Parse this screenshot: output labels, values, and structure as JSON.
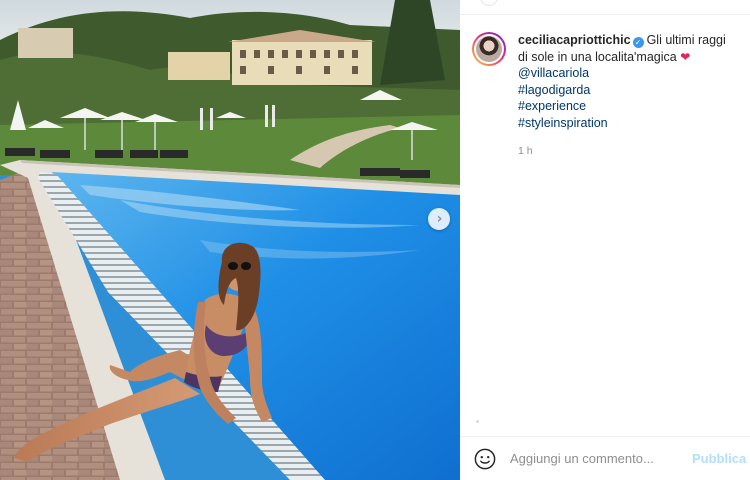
{
  "post": {
    "username": "ceciliacapriottichic",
    "verified_icon": "verified-badge-icon",
    "caption_lines": [
      "Gli ultimi raggi",
      "di sole in una localita'magica"
    ],
    "heart_glyph": "❤",
    "hashtags": [
      "@villacariola",
      "#lagodigarda",
      "#experience",
      "#styleinspiration"
    ],
    "time": "1 h"
  },
  "comment_bar": {
    "placeholder": "Aggiungi un commento...",
    "publish_label": "Pubblica",
    "emoji_icon": "smile-icon"
  },
  "media": {
    "next_icon": "chevron-right-icon",
    "next_glyph": "›"
  },
  "colors": {
    "link": "#00376b",
    "verified": "#3897f0",
    "publish_disabled": "#b2dffc",
    "heart": "#e0245e"
  }
}
